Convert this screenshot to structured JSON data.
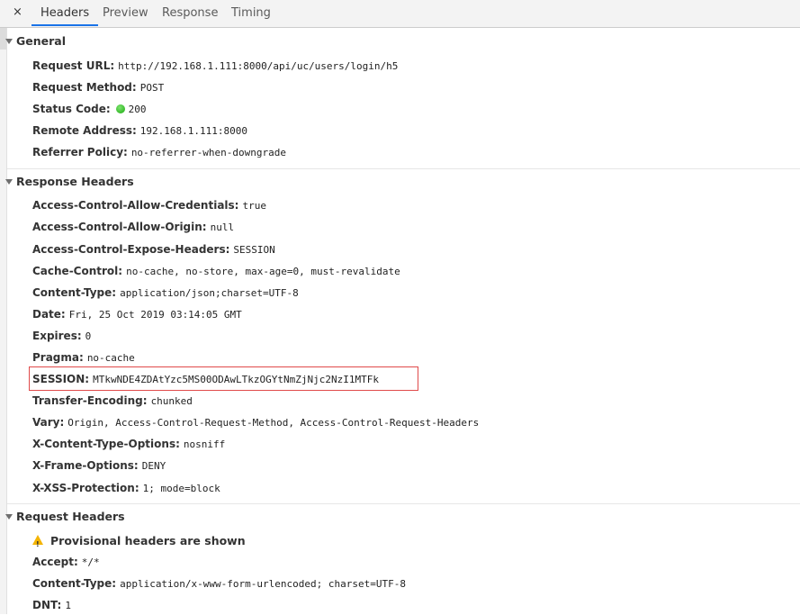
{
  "tabs": {
    "close": "×",
    "items": [
      "Headers",
      "Preview",
      "Response",
      "Timing"
    ],
    "active": "Headers"
  },
  "general": {
    "title": "General",
    "rows": [
      {
        "key": "Request URL:",
        "value": "http://192.168.1.111:8000/api/uc/users/login/h5"
      },
      {
        "key": "Request Method:",
        "value": "POST"
      },
      {
        "key": "Status Code:",
        "value": "200",
        "status_color": "#1aab0d"
      },
      {
        "key": "Remote Address:",
        "value": "192.168.1.111:8000"
      },
      {
        "key": "Referrer Policy:",
        "value": "no-referrer-when-downgrade"
      }
    ]
  },
  "response_headers": {
    "title": "Response Headers",
    "rows": [
      {
        "key": "Access-Control-Allow-Credentials:",
        "value": "true"
      },
      {
        "key": "Access-Control-Allow-Origin:",
        "value": "null"
      },
      {
        "key": "Access-Control-Expose-Headers:",
        "value": "SESSION"
      },
      {
        "key": "Cache-Control:",
        "value": "no-cache, no-store, max-age=0, must-revalidate"
      },
      {
        "key": "Content-Type:",
        "value": "application/json;charset=UTF-8"
      },
      {
        "key": "Date:",
        "value": "Fri, 25 Oct 2019 03:14:05 GMT"
      },
      {
        "key": "Expires:",
        "value": "0"
      },
      {
        "key": "Pragma:",
        "value": "no-cache"
      },
      {
        "key": "SESSION:",
        "value": "MTkwNDE4ZDAtYzc5MS00ODAwLTkzOGYtNmZjNjc2NzI1MTFk",
        "highlighted": true
      },
      {
        "key": "Transfer-Encoding:",
        "value": "chunked"
      },
      {
        "key": "Vary:",
        "value": "Origin, Access-Control-Request-Method, Access-Control-Request-Headers"
      },
      {
        "key": "X-Content-Type-Options:",
        "value": "nosniff"
      },
      {
        "key": "X-Frame-Options:",
        "value": "DENY"
      },
      {
        "key": "X-XSS-Protection:",
        "value": "1; mode=block"
      }
    ]
  },
  "request_headers": {
    "title": "Request Headers",
    "warning": "Provisional headers are shown",
    "rows": [
      {
        "key": "Accept:",
        "value": "*/*"
      },
      {
        "key": "Content-Type:",
        "value": "application/x-www-form-urlencoded; charset=UTF-8"
      },
      {
        "key": "DNT:",
        "value": "1"
      }
    ]
  },
  "colors": {
    "highlight_border": "#e04a4a",
    "active_tab_underline": "#1a73e8",
    "warning": "#f4b400"
  }
}
